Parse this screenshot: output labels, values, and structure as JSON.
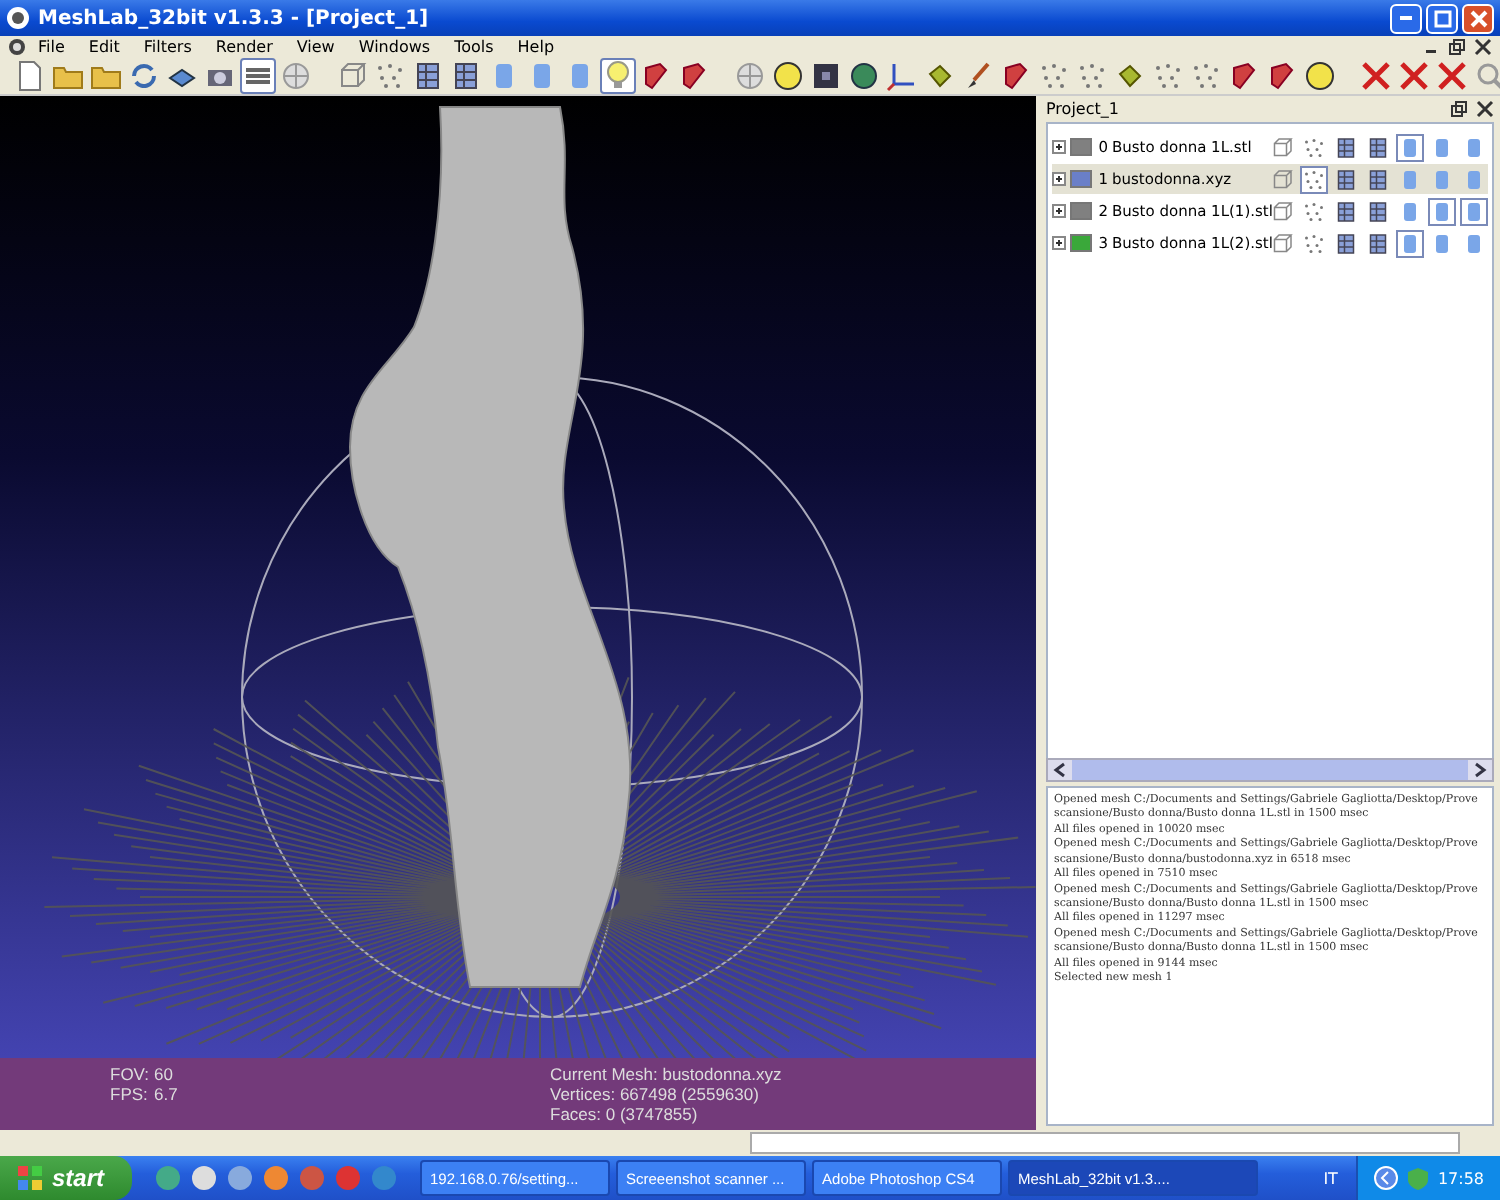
{
  "window": {
    "title": "MeshLab_32bit v1.3.3 - [Project_1]"
  },
  "menu": [
    "File",
    "Edit",
    "Filters",
    "Render",
    "View",
    "Windows",
    "Tools",
    "Help"
  ],
  "toolbar": [
    [
      {
        "kind": "page",
        "selected": false
      },
      {
        "kind": "folder",
        "selected": false
      },
      {
        "kind": "folder",
        "selected": false
      },
      {
        "kind": "arrows",
        "selected": false
      },
      {
        "kind": "disk",
        "selected": false
      },
      {
        "kind": "camera",
        "selected": false
      },
      {
        "kind": "layers",
        "selected": true
      },
      {
        "kind": "sphere",
        "selected": false
      }
    ],
    [
      {
        "kind": "cube",
        "selected": false
      },
      {
        "kind": "dots",
        "selected": false
      },
      {
        "kind": "wire",
        "selected": false
      },
      {
        "kind": "wire",
        "selected": false
      },
      {
        "kind": "cyl",
        "selected": false
      },
      {
        "kind": "cyl",
        "selected": false
      },
      {
        "kind": "cyl",
        "selected": false
      },
      {
        "kind": "bulb",
        "selected": true
      },
      {
        "kind": "redbox",
        "selected": false
      },
      {
        "kind": "redbox",
        "selected": false
      }
    ],
    [
      {
        "kind": "sphere",
        "selected": false
      },
      {
        "kind": "yellowcircle",
        "selected": false
      },
      {
        "kind": "darksquare",
        "selected": false
      },
      {
        "kind": "greenball",
        "selected": false
      },
      {
        "kind": "axes",
        "selected": false
      },
      {
        "kind": "paint",
        "selected": false
      },
      {
        "kind": "brush",
        "selected": false
      },
      {
        "kind": "redbox",
        "selected": false
      },
      {
        "kind": "dots",
        "selected": false
      },
      {
        "kind": "dots",
        "selected": false
      },
      {
        "kind": "paint",
        "selected": false
      },
      {
        "kind": "dots",
        "selected": false
      },
      {
        "kind": "dots",
        "selected": false
      },
      {
        "kind": "redbox",
        "selected": false
      },
      {
        "kind": "redbox",
        "selected": false
      },
      {
        "kind": "yellowcircle",
        "selected": false
      }
    ],
    [
      {
        "kind": "redx",
        "selected": false
      },
      {
        "kind": "redx",
        "selected": false
      },
      {
        "kind": "redx",
        "selected": false
      }
    ]
  ],
  "viewport": {
    "fov_label": "FOV:",
    "fov": "60",
    "fps_label": "FPS:",
    "fps": "6.7",
    "current_mesh": "Current Mesh: bustodonna.xyz",
    "vertices": "Vertices: 667498 (2559630)",
    "faces": "Faces: 0 (3747855)"
  },
  "project_panel": {
    "title": "Project_1",
    "layers": [
      {
        "index": "0",
        "name": "Busto donna 1L.stl",
        "selected": false,
        "color": "#808080",
        "modes": [
          false,
          false,
          false,
          false,
          true,
          false,
          false
        ]
      },
      {
        "index": "1",
        "name": "bustodonna.xyz",
        "selected": true,
        "color": "#6a7fc8",
        "modes": [
          false,
          true,
          false,
          false,
          false,
          false,
          false
        ]
      },
      {
        "index": "2",
        "name": "Busto donna 1L(1).stl",
        "selected": false,
        "color": "#808080",
        "modes": [
          false,
          false,
          false,
          false,
          false,
          true,
          true
        ]
      },
      {
        "index": "3",
        "name": "Busto donna 1L(2).stl",
        "selected": false,
        "color": "#3aa83a",
        "modes": [
          false,
          false,
          false,
          false,
          true,
          false,
          false
        ]
      }
    ],
    "log": [
      "Opened mesh C:/Documents and Settings/Gabriele Gagliotta/Desktop/Prove scansione/Busto donna/Busto donna 1L.stl in 1500 msec",
      "All files opened in 10020 msec",
      "Opened mesh C:/Documents and Settings/Gabriele Gagliotta/Desktop/Prove scansione/Busto donna/bustodonna.xyz in 6518 msec",
      "All files opened in 7510 msec",
      "Opened mesh C:/Documents and Settings/Gabriele Gagliotta/Desktop/Prove scansione/Busto donna/Busto donna 1L.stl in 1500 msec",
      "All files opened in 11297 msec",
      "Opened mesh C:/Documents and Settings/Gabriele Gagliotta/Desktop/Prove scansione/Busto donna/Busto donna 1L.stl in 1500 msec",
      "All files opened in 9144 msec",
      "Selected new mesh 1"
    ]
  },
  "taskbar": {
    "start": "start",
    "tasks": [
      {
        "label": "192.168.0.76/setting...",
        "selected": false
      },
      {
        "label": "Screeenshot scanner ...",
        "selected": false
      },
      {
        "label": "Adobe Photoshop CS4",
        "selected": false
      },
      {
        "label": "MeshLab_32bit v1.3....",
        "selected": true
      }
    ],
    "language": "IT",
    "time": "17:58"
  }
}
